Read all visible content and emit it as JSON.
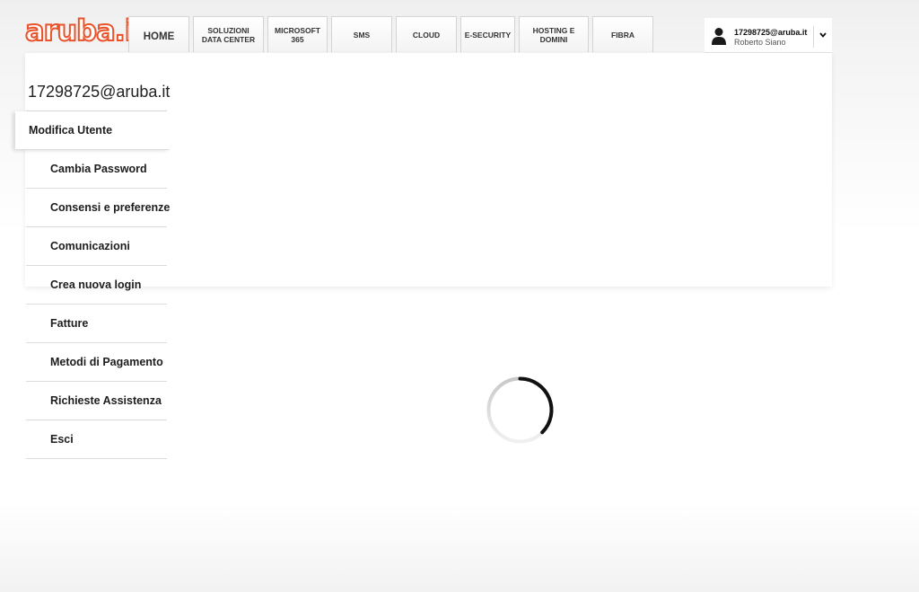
{
  "header": {
    "logo_text": "aruba.it",
    "brand_color": "#e8532b",
    "nav_tabs": [
      {
        "label": "HOME"
      },
      {
        "label": "SOLUZIONI\nDATA CENTER"
      },
      {
        "label": "MICROSOFT\n365"
      },
      {
        "label": "SMS"
      },
      {
        "label": "CLOUD"
      },
      {
        "label": "E-SECURITY"
      },
      {
        "label": "HOSTING E\nDOMINI"
      },
      {
        "label": "FIBRA"
      }
    ],
    "user": {
      "email": "17298725@aruba.it",
      "name": "Roberto Siano",
      "icon": "user-icon",
      "dropdown_icon": "chevron-down-icon"
    }
  },
  "sidebar": {
    "account_title": "17298725@aruba.it",
    "items": [
      {
        "label": "Modifica Utente",
        "active": true
      },
      {
        "label": "Cambia Password"
      },
      {
        "label": "Consensi e preferenze"
      },
      {
        "label": "Comunicazioni"
      },
      {
        "label": "Crea nuova login"
      },
      {
        "label": "Fatture"
      },
      {
        "label": "Metodi di Pagamento"
      },
      {
        "label": "Richieste Assistenza"
      },
      {
        "label": "Esci"
      }
    ]
  },
  "main": {
    "loading_icon": "loading-spinner-icon"
  }
}
